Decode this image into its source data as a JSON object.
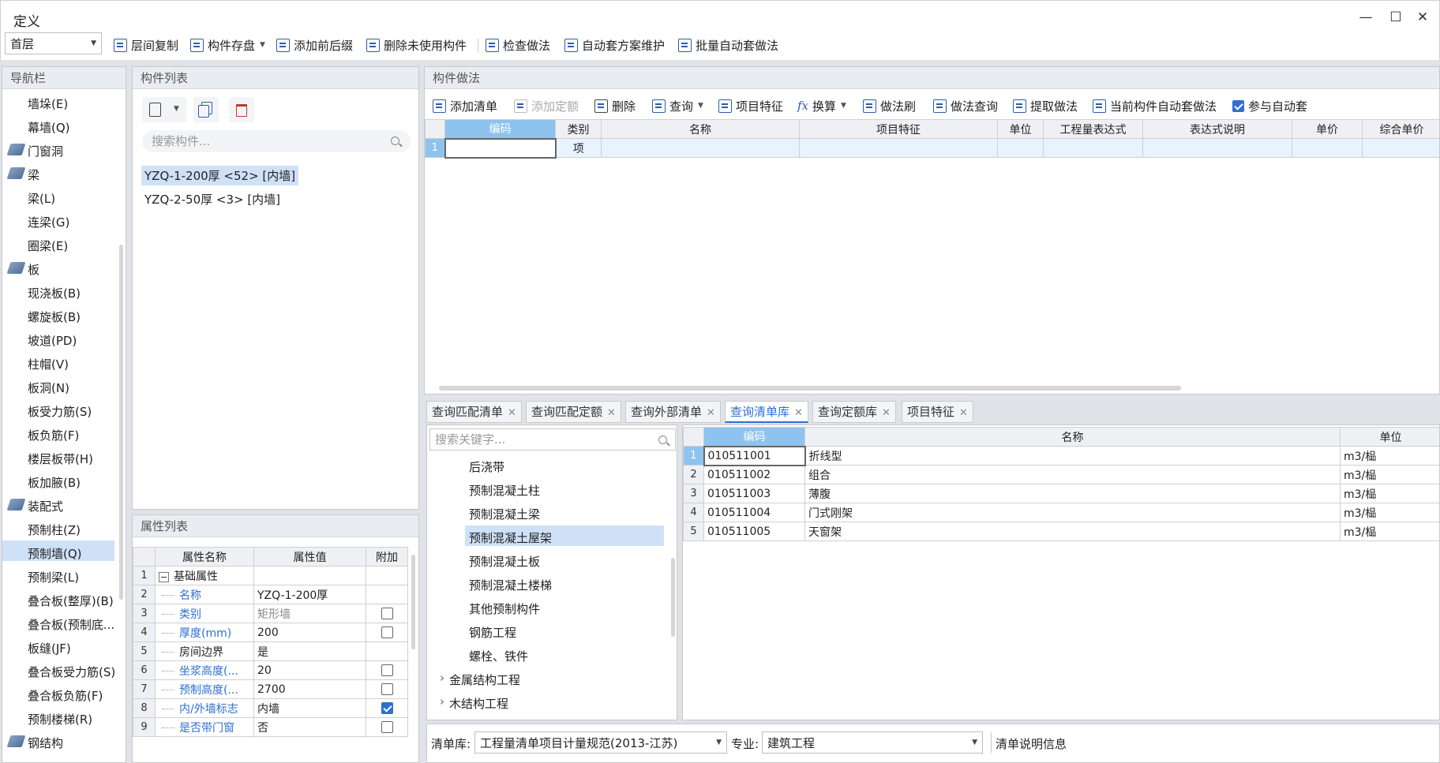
{
  "window": {
    "title": "定义"
  },
  "toolbar": {
    "floor_select": "首层",
    "copy_floor": "层间复制",
    "save_component": "构件存盘",
    "add_prefix_suffix": "添加前后缀",
    "delete_unused": "删除未使用构件",
    "check_method": "检查做法",
    "auto_scheme_maintain": "自动套方案维护",
    "batch_auto_method": "批量自动套做法"
  },
  "nav": {
    "title": "导航栏",
    "items": [
      {
        "label": "墙垛(E)",
        "type": "item"
      },
      {
        "label": "幕墙(Q)",
        "type": "item"
      },
      {
        "label": "门窗洞",
        "type": "cat"
      },
      {
        "label": "梁",
        "type": "cat"
      },
      {
        "label": "梁(L)",
        "type": "item"
      },
      {
        "label": "连梁(G)",
        "type": "item"
      },
      {
        "label": "圈梁(E)",
        "type": "item"
      },
      {
        "label": "板",
        "type": "cat"
      },
      {
        "label": "现浇板(B)",
        "type": "item"
      },
      {
        "label": "螺旋板(B)",
        "type": "item"
      },
      {
        "label": "坡道(PD)",
        "type": "item"
      },
      {
        "label": "柱帽(V)",
        "type": "item"
      },
      {
        "label": "板洞(N)",
        "type": "item"
      },
      {
        "label": "板受力筋(S)",
        "type": "item"
      },
      {
        "label": "板负筋(F)",
        "type": "item"
      },
      {
        "label": "楼层板带(H)",
        "type": "item"
      },
      {
        "label": "板加腋(B)",
        "type": "item"
      },
      {
        "label": "装配式",
        "type": "cat"
      },
      {
        "label": "预制柱(Z)",
        "type": "item"
      },
      {
        "label": "预制墙(Q)",
        "type": "item",
        "selected": true
      },
      {
        "label": "预制梁(L)",
        "type": "item"
      },
      {
        "label": "叠合板(整厚)(B)",
        "type": "item"
      },
      {
        "label": "叠合板(预制底...",
        "type": "item"
      },
      {
        "label": "板缝(JF)",
        "type": "item"
      },
      {
        "label": "叠合板受力筋(S)",
        "type": "item"
      },
      {
        "label": "叠合板负筋(F)",
        "type": "item"
      },
      {
        "label": "预制楼梯(R)",
        "type": "item"
      },
      {
        "label": "钢结构",
        "type": "cat"
      }
    ]
  },
  "components": {
    "title": "构件列表",
    "search_placeholder": "搜索构件...",
    "items": [
      {
        "label": "YZQ-1-200厚 <52> [内墙]",
        "selected": true
      },
      {
        "label": "YZQ-2-50厚 <3> [内墙]"
      }
    ]
  },
  "props": {
    "title": "属性列表",
    "headers": [
      "属性名称",
      "属性值",
      "附加"
    ],
    "rows": [
      {
        "n": "1",
        "name": "基础属性",
        "value": "",
        "group": true,
        "chk": null
      },
      {
        "n": "2",
        "name": "名称",
        "value": "YZQ-1-200厚",
        "blue": true,
        "chk": null
      },
      {
        "n": "3",
        "name": "类别",
        "value": "矩形墙",
        "blue": true,
        "gray": true,
        "chk": false
      },
      {
        "n": "4",
        "name": "厚度(mm)",
        "value": "200",
        "blue": true,
        "chk": false
      },
      {
        "n": "5",
        "name": "房间边界",
        "value": "是",
        "chk": null
      },
      {
        "n": "6",
        "name": "坐浆高度(...",
        "value": "20",
        "blue": true,
        "chk": false
      },
      {
        "n": "7",
        "name": "预制高度(...",
        "value": "2700",
        "blue": true,
        "chk": false
      },
      {
        "n": "8",
        "name": "内/外墙标志",
        "value": "内墙",
        "blue": true,
        "chk": true
      },
      {
        "n": "9",
        "name": "是否带门窗",
        "value": "否",
        "blue": true,
        "chk": false
      }
    ]
  },
  "method": {
    "title": "构件做法",
    "toolbar": {
      "add_list": "添加清单",
      "add_quota": "添加定额",
      "delete": "删除",
      "query": "查询",
      "item_feature": "项目特征",
      "convert": "换算",
      "brush": "做法刷",
      "method_query": "做法查询",
      "extract": "提取做法",
      "current_auto": "当前构件自动套做法",
      "participate_auto": "参与自动套"
    },
    "headers": [
      "编码",
      "类别",
      "名称",
      "项目特征",
      "单位",
      "工程量表达式",
      "表达式说明",
      "单价",
      "综合单价"
    ],
    "rows": [
      {
        "n": "1",
        "code": "",
        "cat": "项"
      }
    ]
  },
  "tabs": [
    {
      "label": "查询匹配清单"
    },
    {
      "label": "查询匹配定额"
    },
    {
      "label": "查询外部清单"
    },
    {
      "label": "查询清单库",
      "active": true
    },
    {
      "label": "查询定额库"
    },
    {
      "label": "项目特征"
    }
  ],
  "query": {
    "search_placeholder": "搜索关键字...",
    "tree": [
      {
        "label": "后浇带"
      },
      {
        "label": "预制混凝土柱"
      },
      {
        "label": "预制混凝土梁"
      },
      {
        "label": "预制混凝土屋架",
        "selected": true
      },
      {
        "label": "预制混凝土板"
      },
      {
        "label": "预制混凝土楼梯"
      },
      {
        "label": "其他预制构件"
      },
      {
        "label": "钢筋工程"
      },
      {
        "label": "螺栓、铁件"
      },
      {
        "label": "金属结构工程",
        "parent": true
      },
      {
        "label": "木结构工程",
        "parent": true
      }
    ],
    "headers": [
      "编码",
      "名称",
      "单位"
    ],
    "rows": [
      {
        "n": "1",
        "code": "010511001",
        "name": "折线型",
        "unit": "m3/榀"
      },
      {
        "n": "2",
        "code": "010511002",
        "name": "组合",
        "unit": "m3/榀"
      },
      {
        "n": "3",
        "code": "010511003",
        "name": "薄腹",
        "unit": "m3/榀"
      },
      {
        "n": "4",
        "code": "010511004",
        "name": "门式刚架",
        "unit": "m3/榀"
      },
      {
        "n": "5",
        "code": "010511005",
        "name": "天窗架",
        "unit": "m3/榀"
      }
    ]
  },
  "bottom": {
    "lib_label": "清单库:",
    "lib_value": "工程量清单项目计量规范(2013-江苏)",
    "major_label": "专业:",
    "major_value": "建筑工程",
    "info": "清单说明信息"
  }
}
